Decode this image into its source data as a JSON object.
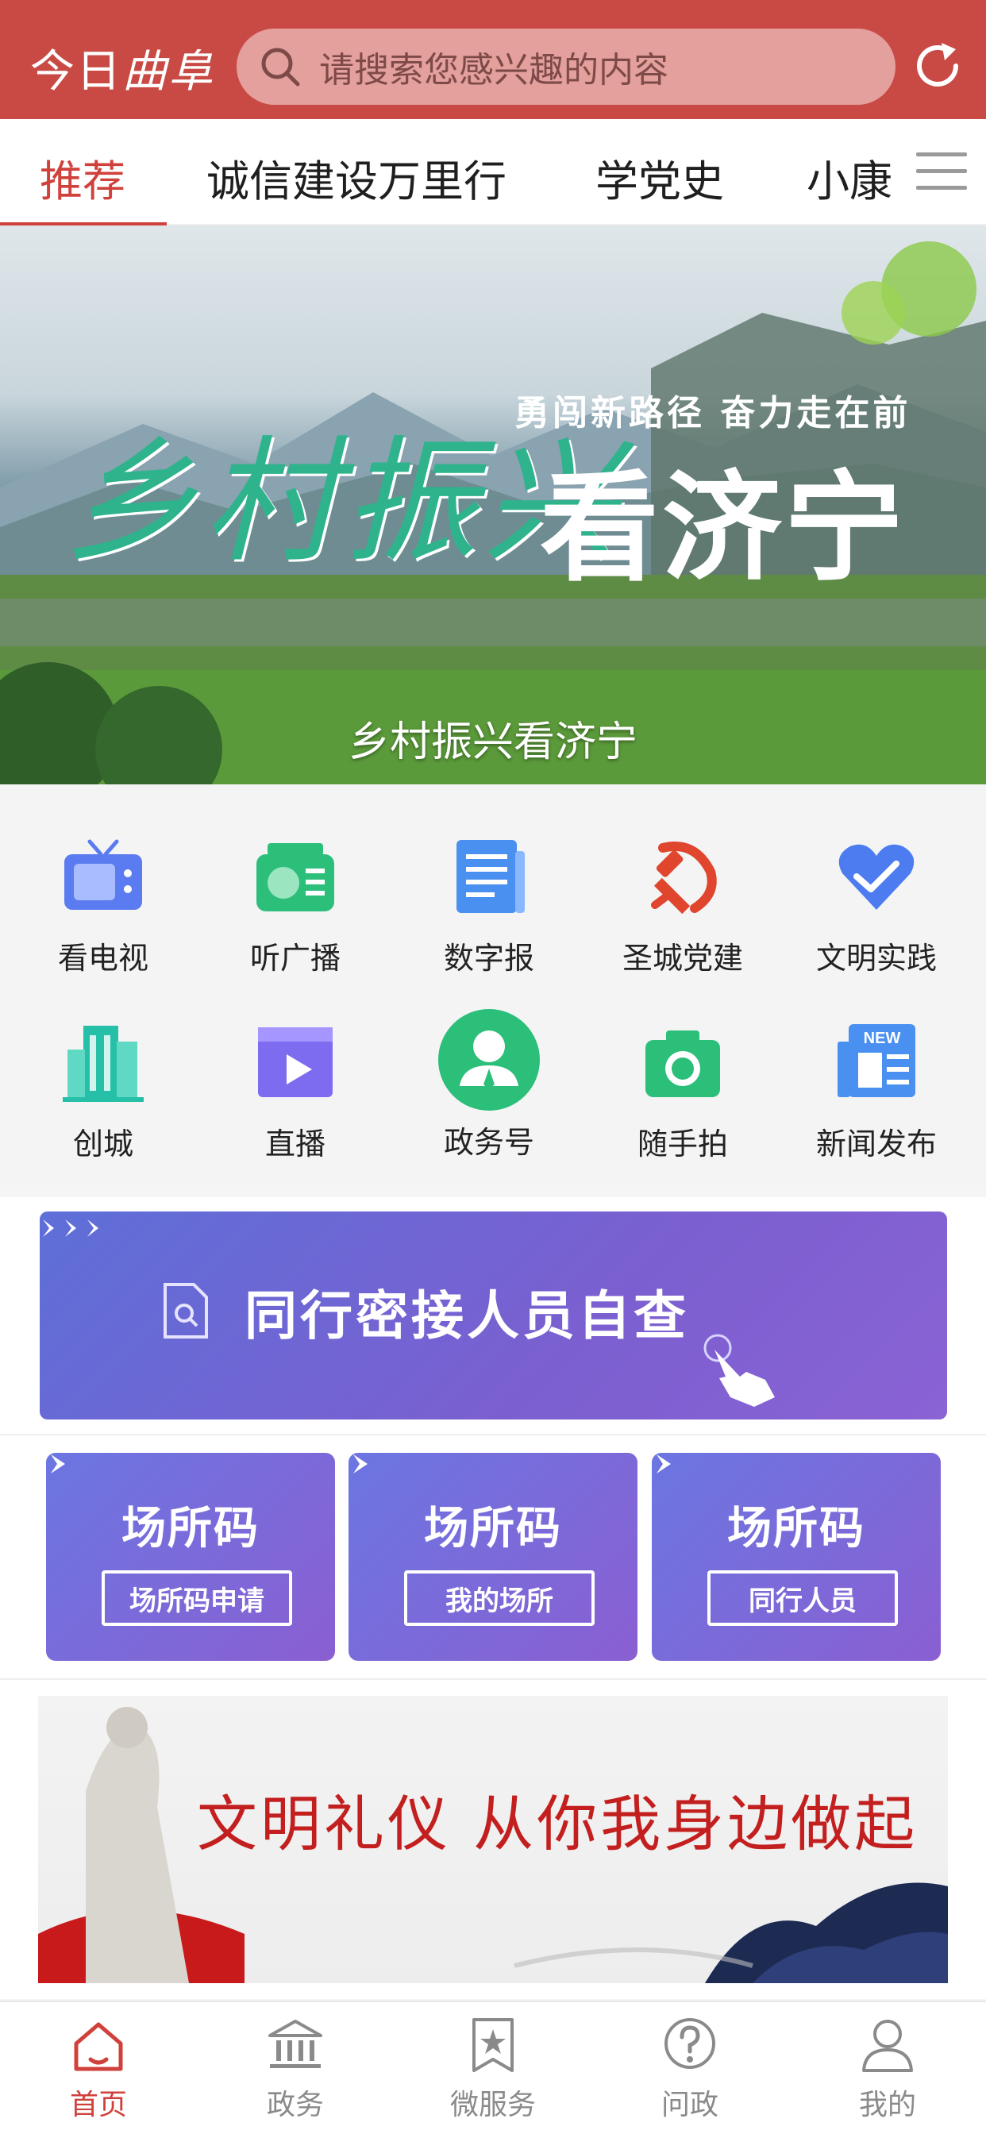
{
  "header": {
    "logo_prefix": "今日",
    "logo_script": "曲阜",
    "search_placeholder": "请搜索您感兴趣的内容"
  },
  "tabs": [
    {
      "label": "推荐",
      "active": true
    },
    {
      "label": "诚信建设万里行"
    },
    {
      "label": "学党史"
    },
    {
      "label": "小康"
    }
  ],
  "banner": {
    "title_calligraphy": "乡村振兴",
    "title_bold": "看济宁",
    "subtitle": "勇闯新路径 奋力走在前",
    "caption": "乡村振兴看济宁"
  },
  "grid": [
    {
      "label": "看电视",
      "icon": "tv-icon",
      "color": "#5b7cf0"
    },
    {
      "label": "听广播",
      "icon": "radio-icon",
      "color": "#2bbf7a"
    },
    {
      "label": "数字报",
      "icon": "newspaper-icon",
      "color": "#4a90f0"
    },
    {
      "label": "圣城党建",
      "icon": "party-emblem-icon",
      "color": "#e0452e"
    },
    {
      "label": "文明实践",
      "icon": "heart-hands-icon",
      "color": "#4d7cf0"
    },
    {
      "label": "创城",
      "icon": "building-icon",
      "color": "#26c0a8"
    },
    {
      "label": "直播",
      "icon": "live-video-icon",
      "color": "#7e6cf0"
    },
    {
      "label": "政务号",
      "icon": "official-user-icon",
      "color": "#2bbf7a"
    },
    {
      "label": "随手拍",
      "icon": "camera-icon",
      "color": "#2bbf7a"
    },
    {
      "label": "新闻发布",
      "icon": "news-release-icon",
      "color": "#4a90f0"
    }
  ],
  "self_check": {
    "label": "同行密接人员自查"
  },
  "venues": [
    {
      "title": "场所码",
      "button": "场所码申请"
    },
    {
      "title": "场所码",
      "button": "我的场所"
    },
    {
      "title": "场所码",
      "button": "同行人员"
    }
  ],
  "civility_banner": {
    "text": "文明礼仪 从你我身边做起"
  },
  "bottom_nav": [
    {
      "label": "首页",
      "icon": "home-icon",
      "active": true
    },
    {
      "label": "政务",
      "icon": "government-icon"
    },
    {
      "label": "微服务",
      "icon": "star-bookmark-icon"
    },
    {
      "label": "问政",
      "icon": "question-icon"
    },
    {
      "label": "我的",
      "icon": "profile-icon"
    }
  ],
  "colors": {
    "brand_red": "#c94a44",
    "active_red": "#d0413b",
    "venue_purple": "#7b6ad9"
  }
}
